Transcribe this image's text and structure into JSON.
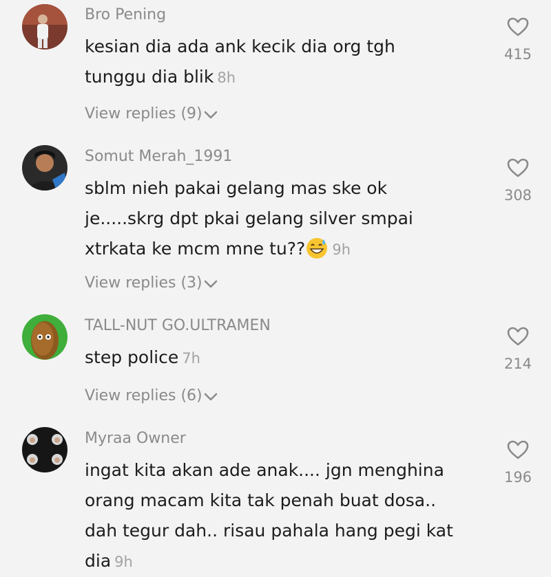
{
  "comments": [
    {
      "username": "Bro Pening",
      "lines": [
        "kesian dia ada ank kecik dia org tgh",
        "tunggu dia blik"
      ],
      "time": "8h",
      "replies_label": "View replies (9)",
      "likes": "415",
      "avatar_icon": "profile-photo"
    },
    {
      "username": "Somut Merah_1991",
      "lines": [
        "sblm nieh pakai gelang mas ske ok",
        "je.....skrg dpt pkai gelang silver smpai",
        "xtrkata ke mcm mne tu??"
      ],
      "emoji": "sweat-smile-emoji",
      "time": "9h",
      "replies_label": "View replies (3)",
      "likes": "308",
      "avatar_icon": "profile-photo"
    },
    {
      "username": "TALL-NUT GO.ULTRAMEN",
      "lines": [
        "step police"
      ],
      "time": "7h",
      "replies_label": "View replies (6)",
      "likes": "214",
      "avatar_icon": "tall-nut-avatar"
    },
    {
      "username": "Myraa Owner",
      "lines": [
        "ingat kita akan ade anak.... jgn menghina",
        "orang macam kita tak penah buat dosa..",
        "dah tegur dah.. risau pahala hang pegi kat",
        "dia"
      ],
      "time": "9h",
      "likes": "196",
      "avatar_icon": "profile-photo-collage"
    }
  ],
  "icons": {
    "like": "heart-outline-icon",
    "expand": "chevron-down-icon"
  },
  "colors": {
    "background": "#f3f3f3",
    "username": "#8a8a8a",
    "text": "#1c1c1c"
  }
}
